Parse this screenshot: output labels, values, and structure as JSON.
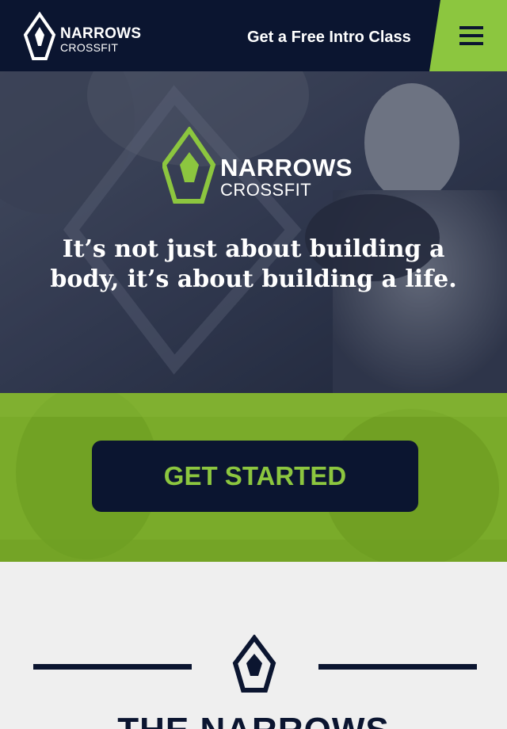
{
  "header": {
    "logo": {
      "word1": "NARROWS",
      "word2": "CROSSFIT"
    },
    "cta_link": "Get a Free Intro Class",
    "menu_icon": "hamburger-menu-icon"
  },
  "hero": {
    "logo": {
      "word1": "NARROWS",
      "word2": "CROSSFIT"
    },
    "tagline": "It’s not just about building a body, it’s about building a life."
  },
  "cta": {
    "button_label": "GET STARTED"
  },
  "section": {
    "title": "THE NARROWS"
  },
  "colors": {
    "navy": "#0b1530",
    "green": "#8cc63f",
    "band_green": "#7aab2a",
    "light_bg": "#efefef"
  }
}
